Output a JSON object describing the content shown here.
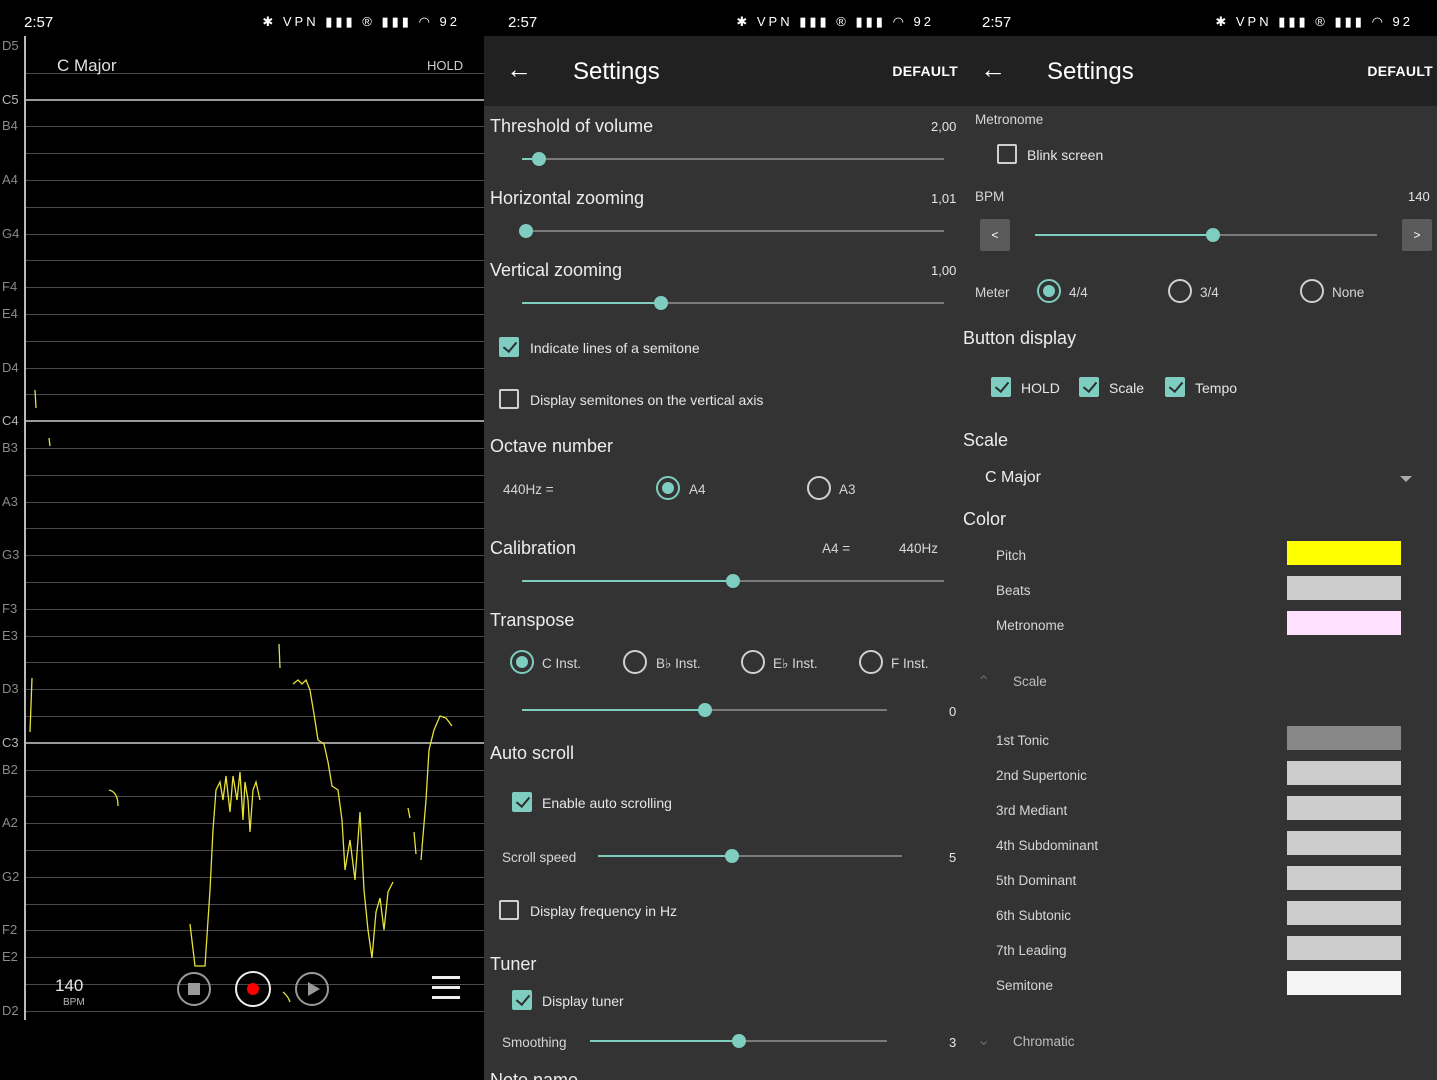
{
  "status_bar": {
    "time": "2:57",
    "battery": "92",
    "indicators": "VPN"
  },
  "panel1": {
    "scale_name": "C Major",
    "hold_label": "HOLD",
    "bpm_value": "140",
    "bpm_unit": "BPM",
    "note_labels": [
      "D5",
      "C5",
      "B4",
      "A4",
      "G4",
      "F4",
      "E4",
      "D4",
      "C4",
      "B3",
      "A3",
      "G3",
      "F3",
      "E3",
      "D3",
      "C3",
      "B2",
      "A2",
      "G2",
      "F2",
      "E2",
      "D2"
    ],
    "pitch_color": "#e6e23a",
    "record_color": "#ff0000"
  },
  "panel2": {
    "title": "Settings",
    "default_label": "DEFAULT",
    "threshold": {
      "label": "Threshold of volume",
      "value": "2,00",
      "fraction": 0.04
    },
    "hzoom": {
      "label": "Horizontal zooming",
      "value": "1,01",
      "fraction": 0.01
    },
    "vzoom": {
      "label": "Vertical zooming",
      "value": "1,00",
      "fraction": 0.33
    },
    "semitone_lines": {
      "label": "Indicate lines of a semitone",
      "checked": true
    },
    "semitone_axis": {
      "label": "Display semitones on the vertical axis",
      "checked": false
    },
    "octave": {
      "label": "Octave number",
      "prefix": "440Hz =",
      "options": [
        "A4",
        "A3"
      ],
      "selected": "A4"
    },
    "calibration": {
      "label": "Calibration",
      "a4_label": "A4 =",
      "hz_value": "440Hz",
      "fraction": 0.5
    },
    "transpose": {
      "label": "Transpose",
      "options": [
        "C Inst.",
        "B♭ Inst.",
        "E♭ Inst.",
        "F Inst."
      ],
      "selected": "C Inst.",
      "value": "0",
      "fraction": 0.5
    },
    "auto_scroll": {
      "label": "Auto scroll",
      "enable_label": "Enable auto scrolling",
      "enabled": true,
      "speed_label": "Scroll speed",
      "speed_value": "5",
      "fraction": 0.44
    },
    "freq_hz": {
      "label": "Display frequency in Hz",
      "checked": false
    },
    "tuner": {
      "label": "Tuner",
      "display_label": "Display tuner",
      "checked": true,
      "smoothing_label": "Smoothing",
      "smoothing_value": "3",
      "fraction": 0.5
    },
    "note_names_partial": "Note name"
  },
  "panel3": {
    "title": "Settings",
    "default_label": "DEFAULT",
    "metronome_label": "Metronome",
    "blink": {
      "label": "Blink screen",
      "checked": false
    },
    "bpm": {
      "label": "BPM",
      "value": "140",
      "fraction": 0.52,
      "dec": "<",
      "inc": ">"
    },
    "meter": {
      "label": "Meter",
      "options": [
        "4/4",
        "3/4",
        "None"
      ],
      "selected": "4/4"
    },
    "button_display": {
      "label": "Button display",
      "items": [
        {
          "label": "HOLD",
          "checked": true
        },
        {
          "label": "Scale",
          "checked": true
        },
        {
          "label": "Tempo",
          "checked": true
        }
      ]
    },
    "scale": {
      "label": "Scale",
      "value": "C Major"
    },
    "color": {
      "label": "Color",
      "items": [
        {
          "label": "Pitch",
          "color": "#ffff00"
        },
        {
          "label": "Beats",
          "color": "#cccccc"
        },
        {
          "label": "Metronome",
          "color": "#ffe0ff"
        }
      ]
    },
    "scale_group": {
      "label": "Scale",
      "items": [
        {
          "label": "1st Tonic",
          "color": "#888888"
        },
        {
          "label": "2nd Supertonic",
          "color": "#cccccc"
        },
        {
          "label": "3rd Mediant",
          "color": "#cccccc"
        },
        {
          "label": "4th Subdominant",
          "color": "#cccccc"
        },
        {
          "label": "5th Dominant",
          "color": "#cccccc"
        },
        {
          "label": "6th Subtonic",
          "color": "#cccccc"
        },
        {
          "label": "7th Leading",
          "color": "#cccccc"
        },
        {
          "label": "Semitone",
          "color": "#f5f5f5"
        }
      ]
    },
    "chromatic_label": "Chromatic"
  }
}
